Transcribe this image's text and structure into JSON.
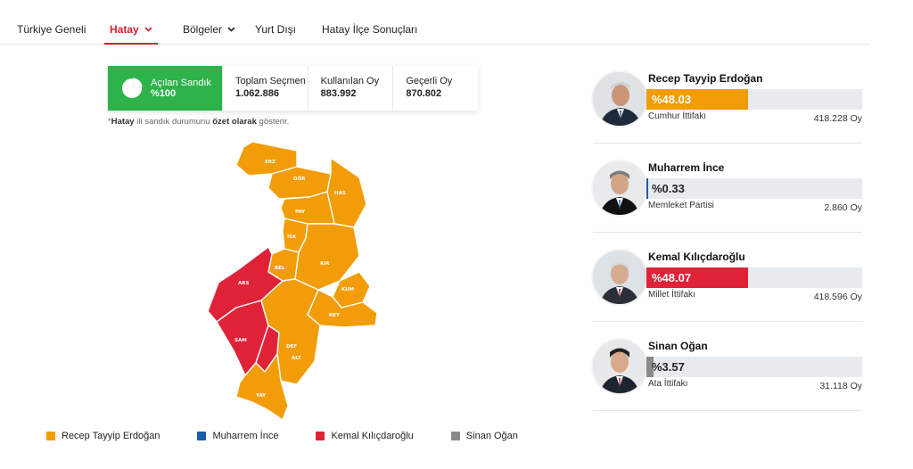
{
  "nav": {
    "items": [
      {
        "label": "Türkiye Geneli"
      },
      {
        "label": "Hatay"
      },
      {
        "label": "Bölgeler"
      },
      {
        "label": "Yurt Dışı"
      },
      {
        "label": "Hatay İlçe Sonuçları"
      }
    ]
  },
  "stats": {
    "opened": {
      "label": "Açılan Sandık",
      "value": "%100"
    },
    "registered": {
      "label": "Toplam Seçmen",
      "value": "1.062.886"
    },
    "used": {
      "label": "Kullanılan Oy",
      "value": "883.992"
    },
    "valid": {
      "label": "Geçerli Oy",
      "value": "870.802"
    }
  },
  "note": {
    "prefix": "*",
    "province": "Hatay",
    "mid": " ili sandık durumunu ",
    "emph": "özet olarak",
    "suffix": " gösterir."
  },
  "map": {
    "districts": [
      {
        "code": "ERZ",
        "winner": "erdogan"
      },
      {
        "code": "DÖR",
        "winner": "erdogan"
      },
      {
        "code": "HAS",
        "winner": "erdogan"
      },
      {
        "code": "PAY",
        "winner": "erdogan"
      },
      {
        "code": "İSK",
        "winner": "erdogan"
      },
      {
        "code": "BEL",
        "winner": "erdogan"
      },
      {
        "code": "KIR",
        "winner": "erdogan"
      },
      {
        "code": "ARS",
        "winner": "kilicdaroglu"
      },
      {
        "code": "KUM",
        "winner": "erdogan"
      },
      {
        "code": "REY",
        "winner": "erdogan"
      },
      {
        "code": "SAM",
        "winner": "kilicdaroglu"
      },
      {
        "code": "DEF",
        "winner": "kilicdaroglu"
      },
      {
        "code": "ALT",
        "winner": "erdogan"
      },
      {
        "code": "YAY",
        "winner": "erdogan"
      }
    ]
  },
  "colors": {
    "erdogan": "#f29c07",
    "ince": "#1a5ea8",
    "kilicdaroglu": "#e02238",
    "ogan": "#8a8a8a",
    "accent": "#d81e2c",
    "green": "#2db34a"
  },
  "legend": [
    {
      "label": "Recep Tayyip Erdoğan",
      "color": "#f29c07"
    },
    {
      "label": "Muharrem İnce",
      "color": "#1a5ea8"
    },
    {
      "label": "Kemal Kılıçdaroğlu",
      "color": "#e02238"
    },
    {
      "label": "Sinan Oğan",
      "color": "#8a8a8a"
    }
  ],
  "candidates": [
    {
      "name": "Recep Tayyip Erdoğan",
      "percent_label": "%48.03",
      "percent": 48.03,
      "party": "Cumhur İttifakı",
      "votes": "418.228 Oy",
      "color": "#f29c07"
    },
    {
      "name": "Muharrem İnce",
      "percent_label": "%0.33",
      "percent": 0.33,
      "party": "Memleket Partisi",
      "votes": "2.860 Oy",
      "color": "#1a5ea8"
    },
    {
      "name": "Kemal Kılıçdaroğlu",
      "percent_label": "%48.07",
      "percent": 48.07,
      "party": "Millet İttifakı",
      "votes": "418.596 Oy",
      "color": "#e02238"
    },
    {
      "name": "Sinan Oğan",
      "percent_label": "%3.57",
      "percent": 3.57,
      "party": "Ata İttifakı",
      "votes": "31.118 Oy",
      "color": "#8a8a8a"
    }
  ]
}
